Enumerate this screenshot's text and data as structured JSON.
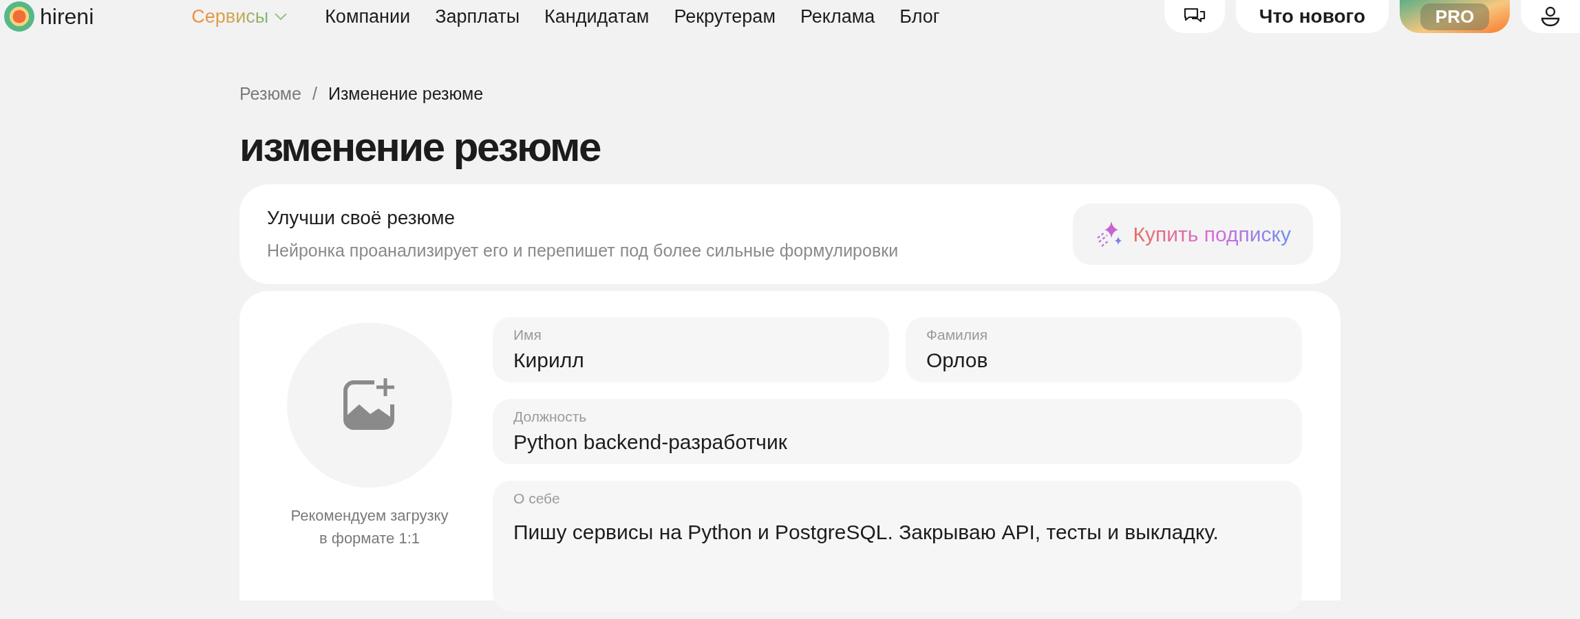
{
  "header": {
    "logo": "hireni",
    "nav": [
      {
        "label": "Сервисы",
        "kind": "dropdown"
      },
      {
        "label": "Компании",
        "kind": "link"
      },
      {
        "label": "Зарплаты",
        "kind": "link"
      },
      {
        "label": "Кандидатам",
        "kind": "link"
      },
      {
        "label": "Рекрутерам",
        "kind": "link"
      },
      {
        "label": "Реклама",
        "kind": "link"
      },
      {
        "label": "Блог",
        "kind": "link"
      }
    ],
    "whats_new": "Что нового",
    "pro": "PRO"
  },
  "breadcrumbs": [
    {
      "label": "Резюме",
      "current": false
    },
    {
      "label": "Изменение резюме",
      "current": true
    }
  ],
  "breadcrumb_separator": "/",
  "title": "изменение резюме",
  "upgrade": {
    "title": "Улучши своё резюме",
    "description": "Нейронка проанализирует его и перепишет под более сильные формулировки",
    "button": "Купить подписку"
  },
  "photo": {
    "hint": "Рекомендуем загрузку в формате 1:1"
  },
  "fields": [
    {
      "label": "Имя",
      "value": "Кирилл",
      "kind": "half"
    },
    {
      "label": "Фамилия",
      "value": "Орлов",
      "kind": "half"
    },
    {
      "label": "Должность",
      "value": "Python backend-разработчик",
      "kind": "full"
    },
    {
      "label": "О себе",
      "value": "Пишу сервисы на Python и PostgreSQL. Закрываю API, тесты и выкладку.",
      "kind": "textarea"
    }
  ]
}
